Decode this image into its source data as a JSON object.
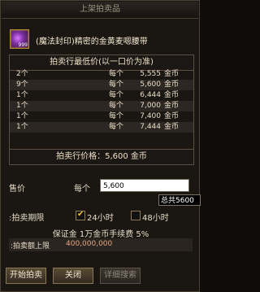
{
  "title": "上架拍卖品",
  "item": {
    "name": "(魔法封印)精密的金黄麦嗯腰带",
    "icon_count": "999"
  },
  "lowest_price_header": "拍卖行最低价(以一口价为准)",
  "listings": [
    {
      "qty": "2个",
      "each": "每个",
      "price": "5,555",
      "unit": "金币"
    },
    {
      "qty": "9个",
      "each": "每个",
      "price": "5,600",
      "unit": "金币"
    },
    {
      "qty": "1个",
      "each": "每个",
      "price": "6,444",
      "unit": "金币"
    },
    {
      "qty": "1个",
      "each": "每个",
      "price": "7,000",
      "unit": "金币"
    },
    {
      "qty": "1个",
      "each": "每个",
      "price": "7,400",
      "unit": "金币"
    },
    {
      "qty": "1个",
      "each": "每个",
      "price": "7,444",
      "unit": "金币"
    }
  ],
  "auction_price_summary": "拍卖行价格：5,600 金币",
  "sell": {
    "label": "售价",
    "per_label": "每个",
    "price_value": "5,600",
    "tooltip": "总共5600"
  },
  "period": {
    "label": ":拍卖期限",
    "option_24": "24小时",
    "option_48": "48小时",
    "selected": "24小时"
  },
  "fee_text": "保证金 1万金币手续费 5%",
  "limit": {
    "label": ":拍卖额上限",
    "value": "400,000,000"
  },
  "buttons": {
    "start": "开始拍卖",
    "close": "关闭",
    "search": "详细搜索"
  }
}
